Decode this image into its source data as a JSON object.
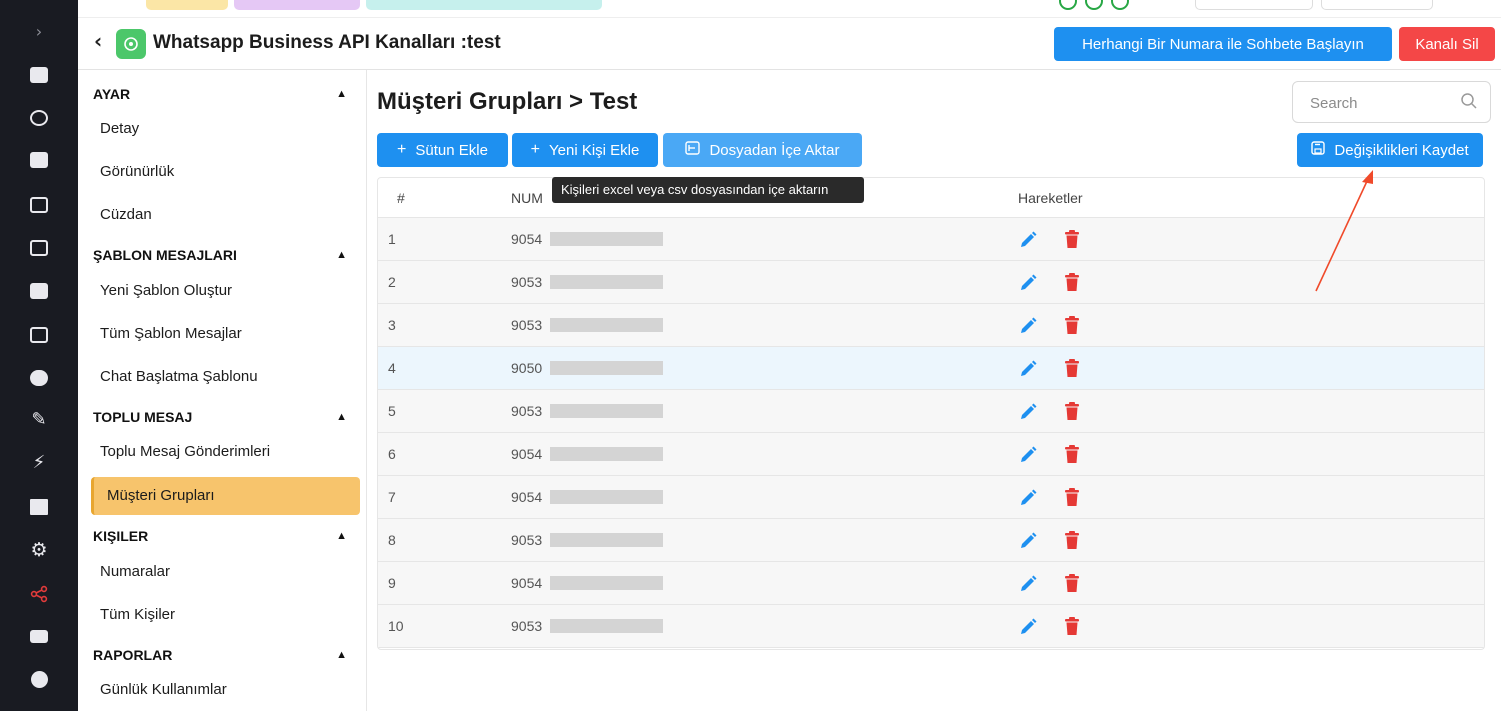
{
  "header": {
    "title": "Whatsapp Business API Kanalları :test",
    "start_chat_label": "Herhangi Bir Numara ile Sohbete Başlayın",
    "delete_channel_label": "Kanalı Sil"
  },
  "sidebar": {
    "sections": [
      {
        "title": "AYAR",
        "items": [
          "Detay",
          "Görünürlük",
          "Cüzdan"
        ]
      },
      {
        "title": "ŞABLON MESAJLARI",
        "items": [
          "Yeni Şablon Oluştur",
          "Tüm Şablon Mesajlar",
          "Chat Başlatma Şablonu"
        ]
      },
      {
        "title": "TOPLU MESAJ",
        "items": [
          "Toplu Mesaj Gönderimleri",
          "Müşteri Grupları"
        ]
      },
      {
        "title": "KIŞILER",
        "items": [
          "Numaralar",
          "Tüm Kişiler"
        ]
      },
      {
        "title": "RAPORLAR",
        "items": [
          "Günlük Kullanımlar"
        ]
      }
    ],
    "active_item": "Müşteri Grupları"
  },
  "main": {
    "breadcrumb": "Müşteri Grupları > Test",
    "search_placeholder": "Search",
    "add_column_label": "Sütun Ekle",
    "add_contact_label": "Yeni Kişi Ekle",
    "import_label": "Dosyadan İçe Aktar",
    "save_label": "Değişiklikleri Kaydet",
    "import_tooltip": "Kişileri excel veya csv dosyasından içe aktarın",
    "table": {
      "columns": [
        "#",
        "NUM",
        "Hareketler"
      ],
      "rows": [
        {
          "index": "1",
          "number_prefix": "9054"
        },
        {
          "index": "2",
          "number_prefix": "9053"
        },
        {
          "index": "3",
          "number_prefix": "9053"
        },
        {
          "index": "4",
          "number_prefix": "9050"
        },
        {
          "index": "5",
          "number_prefix": "9053"
        },
        {
          "index": "6",
          "number_prefix": "9054"
        },
        {
          "index": "7",
          "number_prefix": "9054"
        },
        {
          "index": "8",
          "number_prefix": "9053"
        },
        {
          "index": "9",
          "number_prefix": "9054"
        },
        {
          "index": "10",
          "number_prefix": "9053"
        }
      ],
      "highlighted_row": "4"
    }
  },
  "colors": {
    "primary": "#1e90f0",
    "danger": "#f44747",
    "active_nav": "#f7c46c",
    "rail": "#191b22",
    "edit_icon": "#1e90f0",
    "delete_icon": "#e53935",
    "annotation_arrow": "#f04a2a"
  },
  "icons": {
    "rail": [
      "expand-icon",
      "chat-icon",
      "bot-icon",
      "contacts-icon",
      "mail-icon",
      "clipboard-icon",
      "ticket-icon",
      "inbox-icon",
      "users-icon",
      "pen-icon",
      "bolt-icon",
      "grid-icon",
      "settings-icon",
      "share-icon",
      "card-icon",
      "pie-chart-icon"
    ],
    "header": [
      "back-icon",
      "whatsapp-icon"
    ],
    "toolbar": [
      "plus-icon",
      "plus-icon",
      "import-icon",
      "save-icon"
    ],
    "row_actions": [
      "pencil-icon",
      "trash-icon"
    ]
  }
}
